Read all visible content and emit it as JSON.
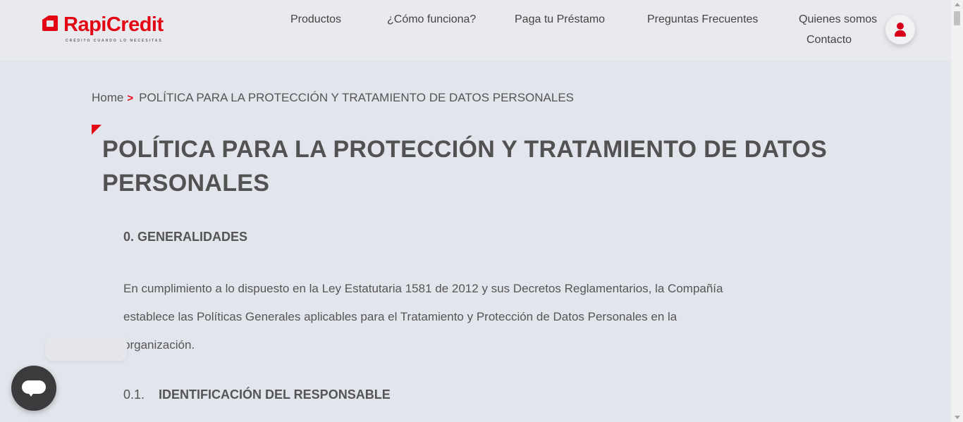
{
  "header": {
    "logo_text": "RapiCredit",
    "logo_tagline": "CRÉDITO CUANDO LO NECESITAS",
    "nav": [
      {
        "label": "Productos"
      },
      {
        "label": "¿Cómo funciona?"
      },
      {
        "label": "Paga tu Préstamo"
      },
      {
        "label": "Preguntas Frecuentes"
      },
      {
        "label": "Quienes somos"
      },
      {
        "label": "Contacto"
      }
    ],
    "user_icon": "user-icon"
  },
  "breadcrumb": {
    "home": "Home",
    "separator": ">",
    "current": "POLÍTICA PARA LA PROTECCIÓN Y TRATAMIENTO DE DATOS PERSONALES"
  },
  "page": {
    "title": "POLÍTICA PARA LA PROTECCIÓN Y TRATAMIENTO DE DATOS PERSONALES",
    "section_0": "0. GENERALIDADES",
    "paragraph_0": "En cumplimiento a lo dispuesto en la Ley Estatutaria 1581 de 2012 y sus Decretos Reglamentarios, la Compañía establece las Políticas Generales aplicables para el Tratamiento y Protección de Datos Personales en la organización.",
    "sub_0_1_number": "0.1.",
    "sub_0_1_title": "IDENTIFICACIÓN DEL RESPONSABLE"
  },
  "chat": {
    "icon": "chat-bubble-icon"
  },
  "colors": {
    "brand": "#e30613",
    "background": "#e3e5ec",
    "header_bg": "#e9eaee",
    "text": "#555555",
    "chat_button": "#3b3b3d"
  }
}
